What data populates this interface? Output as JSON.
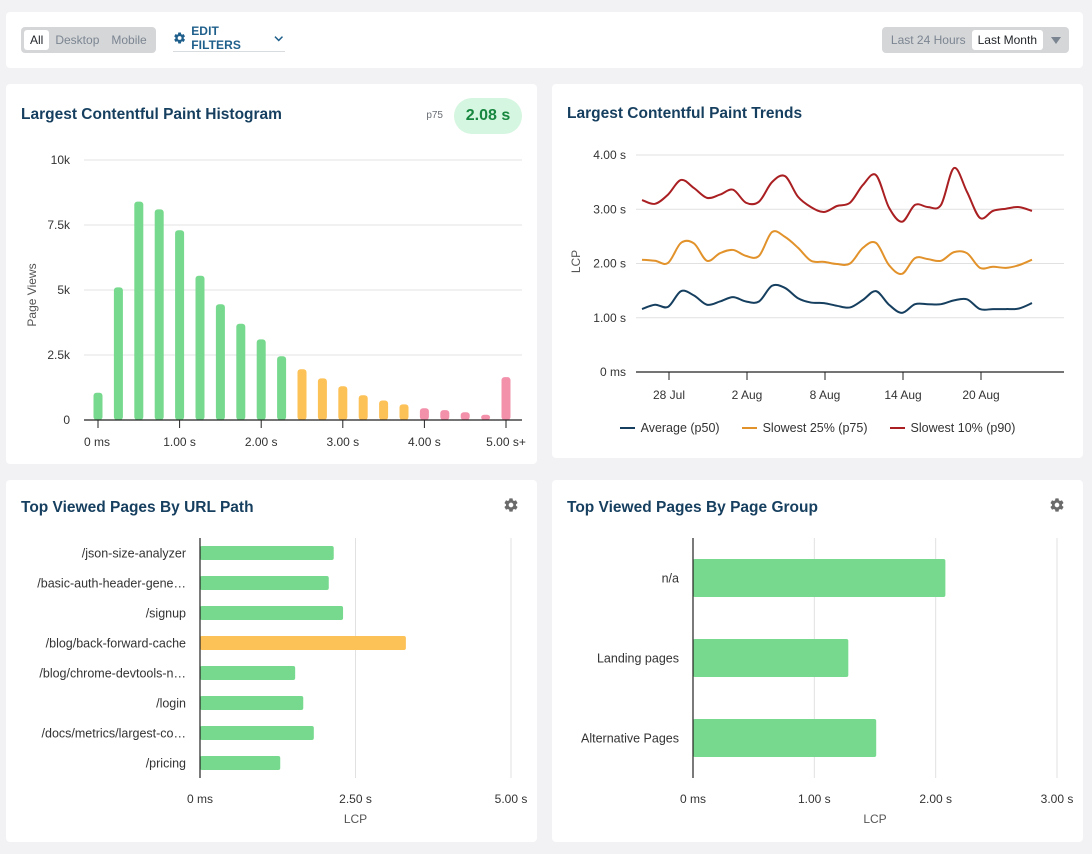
{
  "toolbar": {
    "device_options": [
      {
        "label": "All",
        "active": true
      },
      {
        "label": "Desktop",
        "active": false
      },
      {
        "label": "Mobile",
        "active": false
      }
    ],
    "edit_filters_label": "EDIT FILTERS",
    "edit_filters_icon": "gear-icon",
    "time_options": [
      {
        "label": "Last 24 Hours",
        "active": false
      },
      {
        "label": "Last Month",
        "active": true
      }
    ],
    "time_dropdown_icon": "caret-down-icon"
  },
  "colors": {
    "good": "#77d98e",
    "needs_improvement": "#fcc157",
    "poor": "#f391ab",
    "title": "#163f5f",
    "accent": "#1f5f8b",
    "p50": "#163f5f",
    "p75": "#e2922a",
    "p90": "#a91f22"
  },
  "histogram": {
    "title": "Largest Contentful Paint Histogram",
    "p75_label": "p75",
    "p75_value": "2.08 s"
  },
  "trends": {
    "title": "Largest Contentful Paint Trends"
  },
  "url_panel": {
    "title": "Top Viewed Pages By URL Path",
    "settings_icon": "gear-icon"
  },
  "group_panel": {
    "title": "Top Viewed Pages By Page Group",
    "settings_icon": "gear-icon"
  },
  "chart_data": [
    {
      "id": "histogram",
      "type": "bar",
      "title": "Largest Contentful Paint Histogram",
      "xlabel": "",
      "ylabel": "Page Views",
      "ylim": [
        0,
        10000
      ],
      "yticks": [
        0,
        2500,
        5000,
        7500,
        10000
      ],
      "ytick_labels": [
        "0",
        "2.5k",
        "5k",
        "7.5k",
        "10k"
      ],
      "xtick_labels": [
        "0 ms",
        "1.00 s",
        "2.00 s",
        "3.00 s",
        "4.00 s",
        "5.00 s+"
      ],
      "xtick_bins": [
        0,
        4,
        8,
        12,
        16,
        20
      ],
      "grid": true,
      "categories": [
        "0 ms",
        "0.25 s",
        "0.50 s",
        "0.75 s",
        "1.00 s",
        "1.25 s",
        "1.50 s",
        "1.75 s",
        "2.00 s",
        "2.25 s",
        "2.50 s",
        "2.75 s",
        "3.00 s",
        "3.25 s",
        "3.50 s",
        "3.75 s",
        "4.00 s",
        "4.25 s",
        "4.50 s",
        "4.75 s",
        "5.00 s+"
      ],
      "values": [
        1050,
        5100,
        8400,
        8100,
        7300,
        5550,
        4450,
        3700,
        3100,
        2450,
        1950,
        1600,
        1300,
        950,
        750,
        600,
        450,
        380,
        300,
        200,
        1650
      ],
      "ratings": [
        "good",
        "good",
        "good",
        "good",
        "good",
        "good",
        "good",
        "good",
        "good",
        "good",
        "needs_improvement",
        "needs_improvement",
        "needs_improvement",
        "needs_improvement",
        "needs_improvement",
        "needs_improvement",
        "poor",
        "poor",
        "poor",
        "poor",
        "poor"
      ]
    },
    {
      "id": "trends",
      "type": "line",
      "title": "Largest Contentful Paint Trends",
      "xlabel": "",
      "ylabel": "LCP",
      "ylim": [
        0,
        4
      ],
      "yticks": [
        0,
        1,
        2,
        3,
        4
      ],
      "ytick_labels": [
        "0 ms",
        "1.00 s",
        "2.00 s",
        "3.00 s",
        "4.00 s"
      ],
      "xtick_labels": [
        "28 Jul",
        "2 Aug",
        "8 Aug",
        "14 Aug",
        "20 Aug"
      ],
      "xtick_index": [
        2,
        8,
        14,
        20,
        26
      ],
      "x_start": "26 Jul",
      "grid": true,
      "legend": "bottom",
      "series": [
        {
          "name": "Average (p50)",
          "color": "#163f5f",
          "values": [
            1.16,
            1.24,
            1.2,
            1.49,
            1.41,
            1.24,
            1.3,
            1.38,
            1.3,
            1.3,
            1.59,
            1.55,
            1.36,
            1.28,
            1.27,
            1.22,
            1.19,
            1.33,
            1.49,
            1.24,
            1.09,
            1.25,
            1.25,
            1.25,
            1.32,
            1.34,
            1.16,
            1.16,
            1.16,
            1.17,
            1.27
          ]
        },
        {
          "name": "Slowest 25% (p75)",
          "color": "#e2922a",
          "values": [
            2.07,
            2.05,
            2.01,
            2.38,
            2.37,
            2.05,
            2.19,
            2.25,
            2.14,
            2.14,
            2.58,
            2.49,
            2.29,
            2.05,
            2.03,
            1.99,
            2.0,
            2.29,
            2.38,
            1.97,
            1.81,
            2.1,
            2.08,
            2.05,
            2.21,
            2.19,
            1.92,
            1.94,
            1.92,
            1.97,
            2.07
          ]
        },
        {
          "name": "Slowest 10% (p90)",
          "color": "#a91f22",
          "values": [
            3.17,
            3.1,
            3.27,
            3.54,
            3.39,
            3.21,
            3.27,
            3.36,
            3.12,
            3.14,
            3.5,
            3.61,
            3.23,
            3.04,
            2.95,
            3.06,
            3.12,
            3.45,
            3.63,
            3.03,
            2.77,
            3.08,
            3.04,
            3.08,
            3.76,
            3.32,
            2.84,
            2.97,
            3.01,
            3.04,
            2.97
          ]
        }
      ]
    },
    {
      "id": "url_path",
      "type": "bar",
      "orientation": "horizontal",
      "title": "Top Viewed Pages By URL Path",
      "xlabel": "LCP",
      "ylabel": "",
      "xlim": [
        0,
        5
      ],
      "xticks": [
        0,
        2.5,
        5
      ],
      "xtick_labels": [
        "0 ms",
        "2.50 s",
        "5.00 s"
      ],
      "grid": true,
      "categories": [
        "/json-size-analyzer",
        "/basic-auth-header-gene…",
        "/signup",
        "/blog/back-forward-cache",
        "/blog/chrome-devtools-n…",
        "/login",
        "/docs/metrics/largest-co…",
        "/pricing"
      ],
      "values": [
        2.15,
        2.07,
        2.3,
        3.31,
        1.53,
        1.66,
        1.83,
        1.29
      ],
      "ratings": [
        "good",
        "good",
        "good",
        "needs_improvement",
        "good",
        "good",
        "good",
        "good"
      ]
    },
    {
      "id": "page_group",
      "type": "bar",
      "orientation": "horizontal",
      "title": "Top Viewed Pages By Page Group",
      "xlabel": "LCP",
      "ylabel": "",
      "xlim": [
        0,
        3
      ],
      "xticks": [
        0,
        1,
        2,
        3
      ],
      "xtick_labels": [
        "0 ms",
        "1.00 s",
        "2.00 s",
        "3.00 s"
      ],
      "grid": true,
      "categories": [
        "n/a",
        "Landing pages",
        "Alternative Pages"
      ],
      "values": [
        2.08,
        1.28,
        1.51
      ],
      "ratings": [
        "good",
        "good",
        "good"
      ]
    }
  ]
}
